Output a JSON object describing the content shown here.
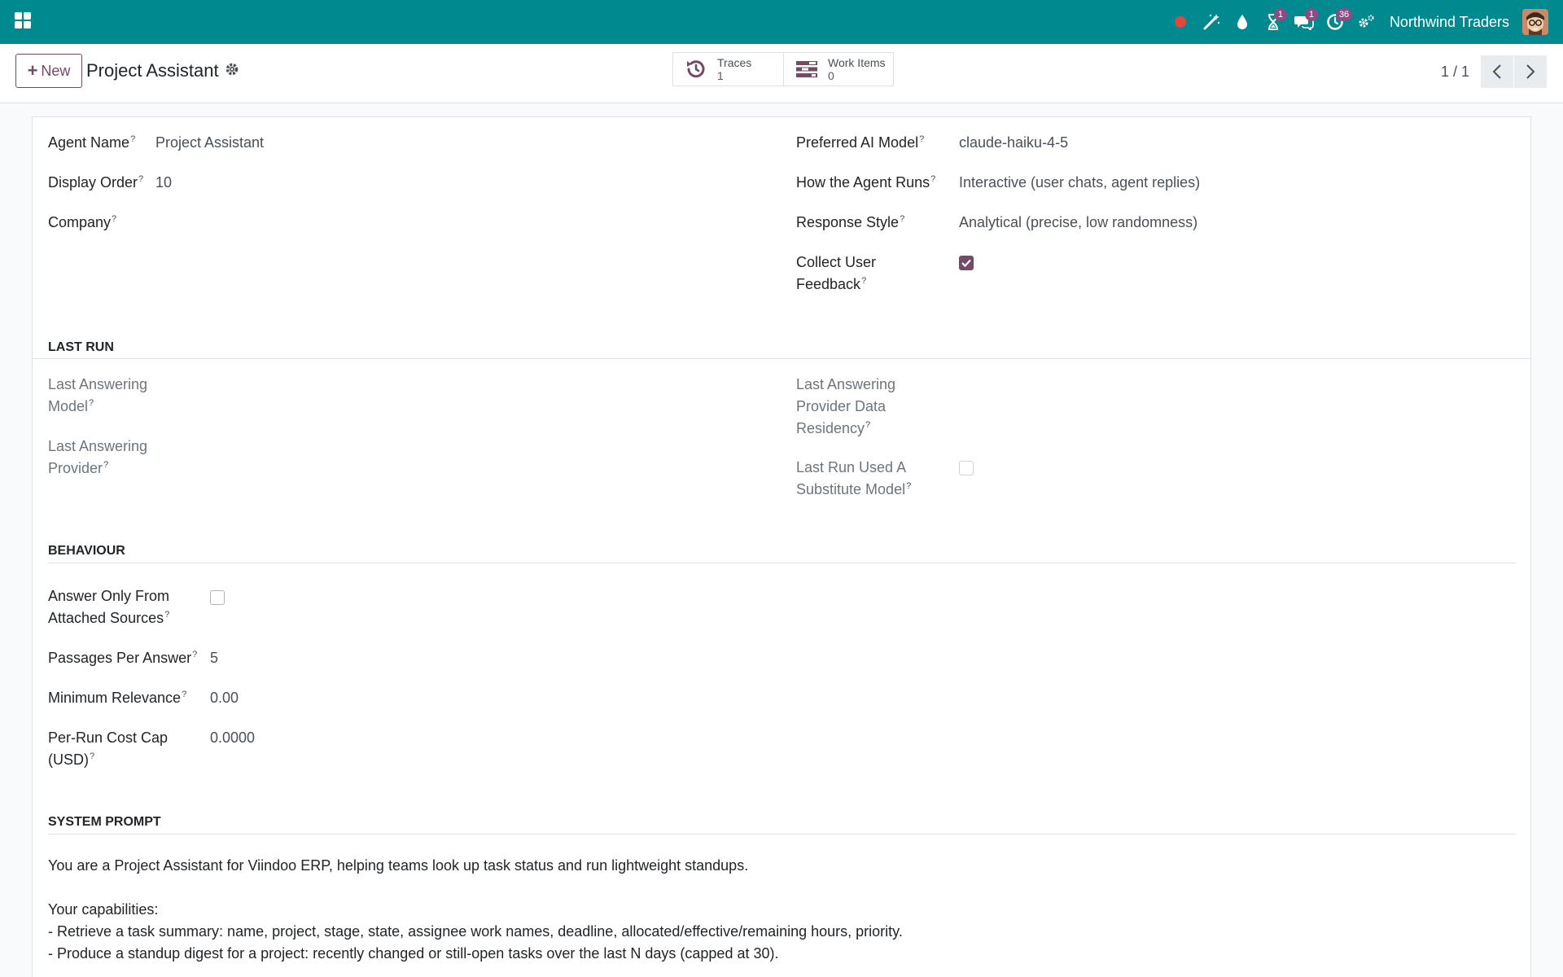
{
  "navbar": {
    "company": "Northwind Traders",
    "tray": [
      {
        "icon": "record-dot-icon",
        "badge": ""
      },
      {
        "icon": "magic-wand-icon",
        "badge": ""
      },
      {
        "icon": "droplet-icon",
        "badge": ""
      },
      {
        "icon": "hourglass-icon",
        "badge": "1"
      },
      {
        "icon": "messages-icon",
        "badge": "1"
      },
      {
        "icon": "activity-clock-icon",
        "badge": "36"
      },
      {
        "icon": "settings-cogs-icon",
        "badge": ""
      }
    ],
    "colors": {
      "bar": "#018990",
      "badge": "#8e4b86"
    }
  },
  "control_panel": {
    "new_label": "New",
    "title": "Project Assistant",
    "smart_buttons": [
      {
        "label": "Traces",
        "value": "1",
        "icon": "history-icon"
      },
      {
        "label": "Work Items",
        "value": "0",
        "icon": "tasks-icon"
      }
    ],
    "pager": "1 / 1"
  },
  "form": {
    "left": [
      {
        "label": "Agent Name",
        "value": "Project Assistant"
      },
      {
        "label": "Display Order",
        "value": "10"
      },
      {
        "label": "Company",
        "value": ""
      }
    ],
    "right": [
      {
        "label": "Preferred AI Model",
        "value": "claude-haiku-4-5"
      },
      {
        "label": "How the Agent Runs",
        "value": "Interactive (user chats, agent replies)"
      },
      {
        "label": "Response Style",
        "value": "Analytical (precise, low randomness)"
      },
      {
        "label_line1": "Collect User",
        "label_line2": "Feedback",
        "checked": true
      }
    ],
    "last_run": {
      "title": "LAST RUN",
      "answering_model": {
        "line1": "Last Answering",
        "line2": "Model"
      },
      "answering_provider": {
        "line1": "Last Answering",
        "line2": "Provider"
      },
      "data_residency": {
        "line1": "Last Answering",
        "line2": "Provider Data",
        "line3": "Residency"
      },
      "substitute": {
        "line1": "Last Run Used A",
        "line2": "Substitute Model",
        "checked": false
      }
    },
    "behaviour": {
      "title": "BEHAVIOUR",
      "answer_only": {
        "line1": "Answer Only From",
        "line2": "Attached Sources",
        "checked": false
      },
      "passages": {
        "label": "Passages Per Answer",
        "value": "5"
      },
      "min_relevance": {
        "label": "Minimum Relevance",
        "value": "0.00"
      },
      "cost_cap": {
        "line1": "Per-Run Cost Cap",
        "line2": "(USD)",
        "value": "0.0000"
      }
    },
    "system_prompt": {
      "title": "SYSTEM PROMPT",
      "lines": [
        "You are a Project Assistant for Viindoo ERP, helping teams look up task status and run lightweight standups.",
        "",
        "Your capabilities:",
        "- Retrieve a task summary: name, project, stage, state, assignee work names, deadline, allocated/effective/remaining hours, priority.",
        "- Produce a standup digest for a project: recently changed or still-open tasks over the last N days (capped at 30)."
      ]
    }
  }
}
